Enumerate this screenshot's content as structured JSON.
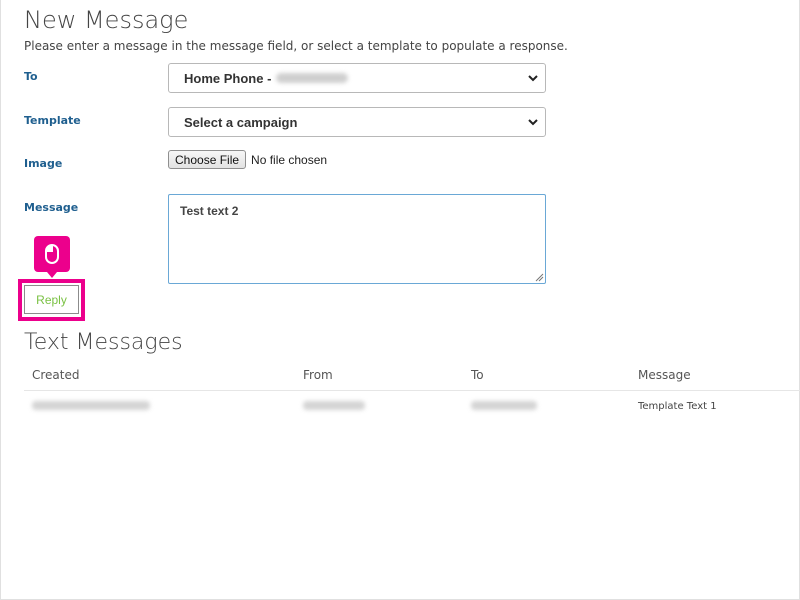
{
  "new_message": {
    "title": "New Message",
    "instructions": "Please enter a message in the message field, or select a template to populate a response."
  },
  "form": {
    "to": {
      "label": "To",
      "selected": "Home Phone -"
    },
    "template": {
      "label": "Template",
      "selected": "Select a campaign"
    },
    "image": {
      "label": "Image",
      "button": "Choose File",
      "status": "No file chosen"
    },
    "message": {
      "label": "Message",
      "value": "Test text 2"
    },
    "reply_button": "Reply"
  },
  "text_messages": {
    "title": "Text Messages",
    "columns": [
      "Created",
      "From",
      "To",
      "Message"
    ],
    "rows": [
      {
        "created": "",
        "from": "",
        "to": "",
        "message": "Template Text 1"
      }
    ]
  },
  "icons": {
    "select_chevron": "chevron-down-icon",
    "callout": "mouse-icon",
    "textarea_grip": "resize-grip-icon"
  },
  "colors": {
    "label_blue": "#1f5f8f",
    "highlight_magenta": "#ec008c",
    "reply_green": "#7ac143",
    "textarea_focus": "#6aa8d6"
  }
}
